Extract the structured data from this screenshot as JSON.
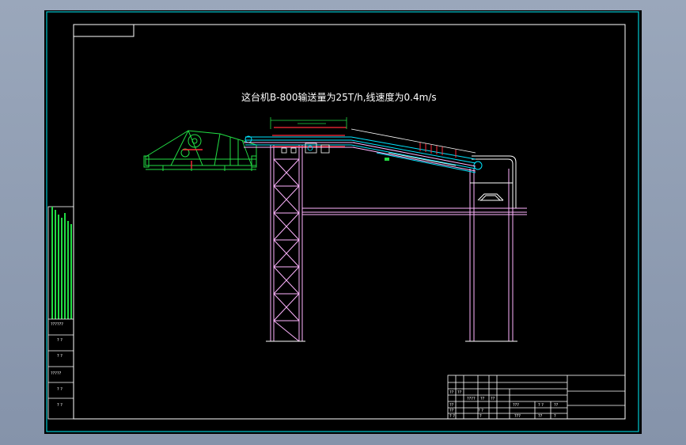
{
  "drawing": {
    "title_note": "这台机B-800输送量为25T/h,线速度为0.4m/s",
    "colors": {
      "frame": "#00c8d2",
      "structure": "#ffb4ff",
      "belt": "#00e5ff",
      "accent": "#ff2a3a",
      "machine": "#22dd44",
      "text": "#ffffff",
      "sheet": "#000000"
    }
  },
  "side_notes": {
    "labels": [
      "??????",
      "? ?",
      "? ?",
      "?????",
      "? ?",
      "? ?"
    ]
  },
  "title_block": {
    "cells": [
      "??",
      "?? ",
      "????",
      "??",
      "??",
      "??",
      "???",
      "? ?",
      "??",
      "??",
      "? ?",
      "? ?",
      "?",
      "???",
      "??",
      "?"
    ]
  }
}
